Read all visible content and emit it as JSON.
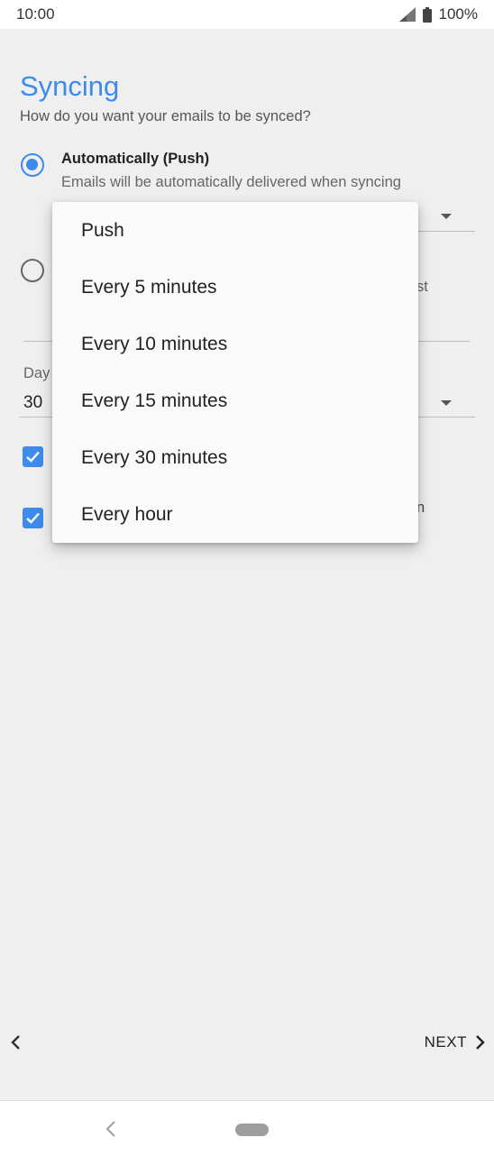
{
  "status_bar": {
    "time": "10:00",
    "battery": "100%"
  },
  "page": {
    "title": "Syncing",
    "subtitle": "How do you want your emails to be synced?"
  },
  "options": {
    "push": {
      "title": "Automatically (Push)",
      "description": "Emails will be automatically delivered when syncing",
      "selected": true
    },
    "scheduled": {
      "selected": false,
      "partial_text": "st"
    }
  },
  "days_field": {
    "label_partial": "Day",
    "value_partial": "30 "
  },
  "checkbox_row": {
    "partial_text": "n"
  },
  "menu": {
    "items": [
      "Push",
      "Every 5 minutes",
      "Every 10 minutes",
      "Every 15 minutes",
      "Every 30 minutes",
      "Every hour"
    ]
  },
  "footer": {
    "next_label": "NEXT"
  },
  "colors": {
    "accent": "#3d8bea",
    "background": "#efefef"
  }
}
